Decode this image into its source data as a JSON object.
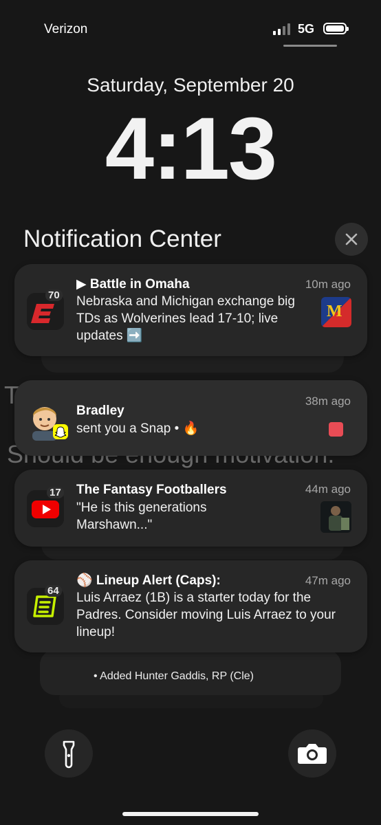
{
  "status_bar": {
    "carrier": "Verizon",
    "network": "5G"
  },
  "lock": {
    "date": "Saturday, September 20",
    "time": "4:13"
  },
  "notification_center": {
    "title": "Notification Center"
  },
  "wallpaper_text": {
    "line1": "T",
    "line2": "Should be enough motivation."
  },
  "notifications": [
    {
      "app": "espn",
      "badge": "70",
      "title": "▶ Battle in Omaha",
      "time": "10m ago",
      "body": "Nebraska and Michigan exchange big TDs as Wolverines lead 17-10; live updates ➡️"
    },
    {
      "app": "snapchat",
      "title": "Bradley",
      "time": "38m ago",
      "body": "sent you a Snap • 🔥"
    },
    {
      "app": "youtube",
      "badge": "17",
      "title": "The Fantasy Footballers",
      "time": "44m ago",
      "body": "\"He is this generations Marshawn...\""
    },
    {
      "app": "espn-fantasy",
      "badge": "64",
      "title": "⚾ Lineup Alert (Caps):",
      "time": "47m ago",
      "body": "Luis Arraez (1B) is a starter today for the Padres.  Consider moving Luis Arraez to your lineup!"
    }
  ],
  "stacked_preview": {
    "text": "• Added Hunter Gaddis, RP (Cle)"
  },
  "colors": {
    "espn_red": "#d8282c",
    "youtube_red": "#f00000",
    "snap_yellow": "#fffc00",
    "fantasy_lime": "#c6f000",
    "snap_square": "#e84c55"
  }
}
